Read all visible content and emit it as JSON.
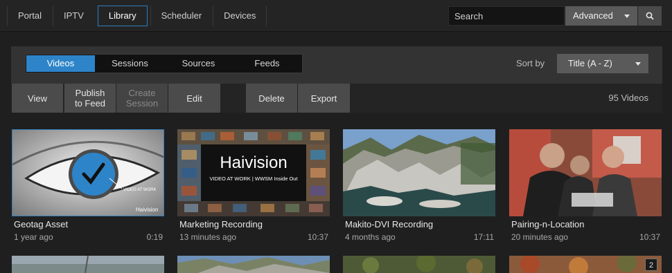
{
  "nav": {
    "items": [
      "Portal",
      "IPTV",
      "Library",
      "Scheduler",
      "Devices"
    ],
    "active": "Library"
  },
  "search": {
    "placeholder": "Search",
    "advanced_label": "Advanced"
  },
  "tabs": [
    "Videos",
    "Sessions",
    "Sources",
    "Feeds"
  ],
  "sort": {
    "label": "Sort by",
    "value": "Title (A - Z)"
  },
  "toolbar": {
    "view": "View",
    "publish_line1": "Publish",
    "publish_line2": "to Feed",
    "create_line1": "Create",
    "create_line2": "Session",
    "edit": "Edit",
    "delete": "Delete",
    "export": "Export",
    "count": "95 Videos"
  },
  "videos": [
    {
      "title": "Geotag Asset",
      "age": "1 year ago",
      "duration": "0:19",
      "thumb_text1": "VIDEO AT WORK",
      "thumb_text2": "Haivision"
    },
    {
      "title": "Marketing Recording",
      "age": "13 minutes ago",
      "duration": "10:37",
      "thumb_text1": "Haivision",
      "thumb_text2": "VIDEO AT WORK | WWSM Inside Out"
    },
    {
      "title": "Makito-DVI Recording",
      "age": "4 months ago",
      "duration": "17:11"
    },
    {
      "title": "Pairing-n-Location",
      "age": "20 minutes ago",
      "duration": "10:37"
    }
  ],
  "second_row_badge": "2",
  "colors": {
    "accent": "#2e84c9",
    "background": "#1f1f1f",
    "panel": "#333333"
  }
}
